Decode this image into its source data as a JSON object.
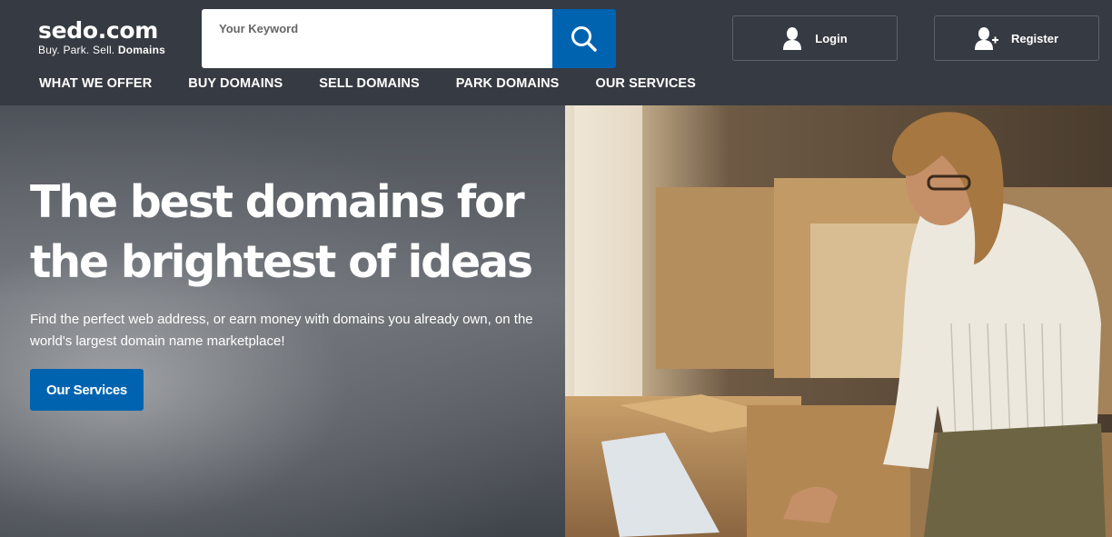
{
  "logo": {
    "name": "sedo.com",
    "tagline_plain": "Buy. Park. Sell.",
    "tagline_bold": "Domains"
  },
  "search": {
    "placeholder": "Your Keyword",
    "value": "",
    "icon": "search-icon"
  },
  "auth": {
    "login_label": "Login",
    "register_label": "Register"
  },
  "nav": {
    "items": [
      "WHAT WE OFFER",
      "BUY DOMAINS",
      "SELL DOMAINS",
      "PARK DOMAINS",
      "OUR SERVICES"
    ]
  },
  "hero": {
    "headline_line1": "The best domains for",
    "headline_line2": "the brightest of ideas",
    "subtext": "Find the perfect web address, or earn money with domains you already own, on the world's largest domain name marketplace!",
    "cta_label": "Our Services"
  },
  "colors": {
    "header_bg": "#363a42",
    "accent_blue": "#0063b0",
    "text": "#ffffff"
  }
}
